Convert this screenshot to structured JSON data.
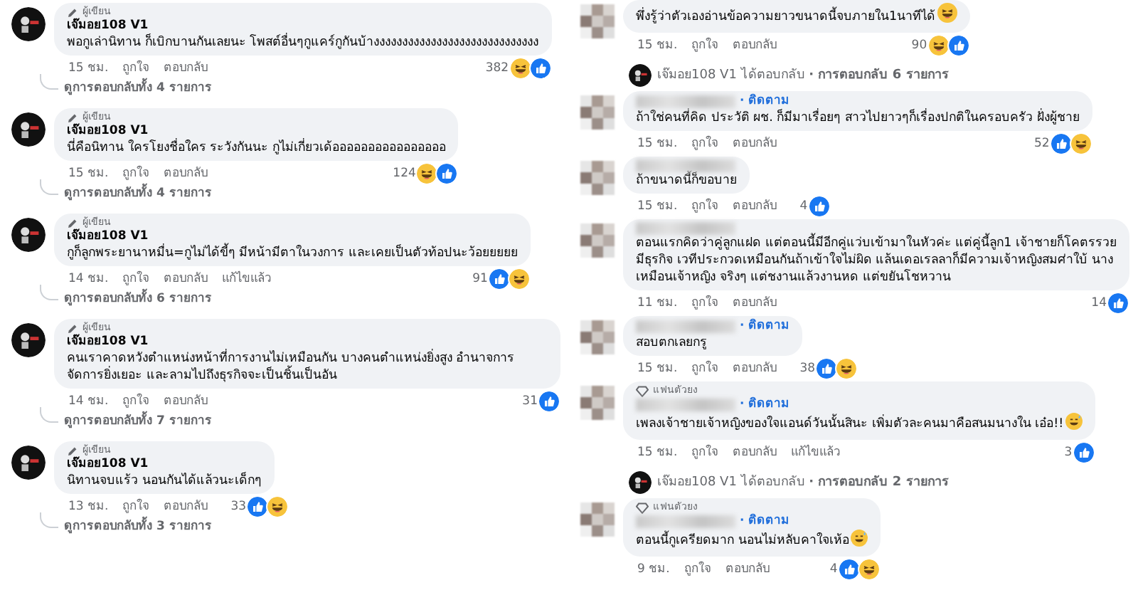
{
  "left": [
    {
      "avatar": {
        "kind": "logo"
      },
      "badge": {
        "kind": "author",
        "label": "ผู้เขียน"
      },
      "author": "เจ๊มอย108 V1",
      "text": "พอกูเล่านิทาน ก็เบิกบานกันเลยนะ โพสต์อื่นๆกูแคร์กูกันบ้างงงงงงงงงงงงงงงงงงงงงงงงงงงงง",
      "time": "15 ชม.",
      "like": "ถูกใจ",
      "reply": "ตอบกลับ",
      "reactions": [
        {
          "kind": "haha"
        },
        {
          "kind": "like"
        }
      ],
      "reaction_count": "382",
      "replies": "ดูการตอบกลับทั้ง 4 รายการ"
    },
    {
      "avatar": {
        "kind": "logo"
      },
      "badge": {
        "kind": "author",
        "label": "ผู้เขียน"
      },
      "author": "เจ๊มอย108 V1",
      "text": "นี่คือนิทาน ใครโยงชื่อใคร ระวังกันนะ กูไม่เกี่ยวเด้ออออออออออออออออ",
      "time": "15 ชม.",
      "like": "ถูกใจ",
      "reply": "ตอบกลับ",
      "reactions": [
        {
          "kind": "haha"
        },
        {
          "kind": "like"
        }
      ],
      "reaction_count": "124",
      "replies": "ดูการตอบกลับทั้ง 4 รายการ"
    },
    {
      "avatar": {
        "kind": "logo"
      },
      "badge": {
        "kind": "author",
        "label": "ผู้เขียน"
      },
      "author": "เจ๊มอย108 V1",
      "text": "กูก็ลูกพระยานาหมื่น=กูไม่ได้ขี้ๆ มีหน้ามีตาในวงการ และเคยเป็นตัวท้อปนะว้อยยยยย",
      "time": "14 ชม.",
      "like": "ถูกใจ",
      "reply": "ตอบกลับ",
      "edited": "แก้ไขแล้ว",
      "reactions": [
        {
          "kind": "like"
        },
        {
          "kind": "haha"
        }
      ],
      "reaction_count": "91",
      "replies": "ดูการตอบกลับทั้ง 6 รายการ"
    },
    {
      "avatar": {
        "kind": "logo"
      },
      "badge": {
        "kind": "author",
        "label": "ผู้เขียน"
      },
      "author": "เจ๊มอย108 V1",
      "text": "คนเราคาดหวังตำแหน่งหน้าที่การงานไม่เหมือนกัน บางคนตำแหน่งยิ่งสูง อำนาจการจัดการยิ่งเยอะ และลามไปถึงธุรกิจจะเป็นชิ้นเป็นอัน",
      "time": "14 ชม.",
      "like": "ถูกใจ",
      "reply": "ตอบกลับ",
      "reactions": [
        {
          "kind": "like"
        }
      ],
      "reaction_count": "31",
      "replies": "ดูการตอบกลับทั้ง 7 รายการ"
    },
    {
      "avatar": {
        "kind": "logo"
      },
      "badge": {
        "kind": "author",
        "label": "ผู้เขียน"
      },
      "author": "เจ๊มอย108 V1",
      "text": "นิทานจบแร้ว นอนกันได้แล้วนะเด็กๆ",
      "time": "13 ชม.",
      "like": "ถูกใจ",
      "reply": "ตอบกลับ",
      "reactions": [
        {
          "kind": "like"
        },
        {
          "kind": "haha"
        }
      ],
      "reaction_count": "33",
      "replies": "ดูการตอบกลับทั้ง 3 รายการ"
    }
  ],
  "right": [
    {
      "kind": "comment",
      "avatar": {
        "kind": "pixelated"
      },
      "text": "พึ่งรู้ว่าตัวเองอ่านข้อความยาวขนาดนี้จบภายใน1นาทีได้",
      "emoji": {
        "kind": "laughing"
      },
      "time": "15 ชม.",
      "like": "ถูกใจ",
      "reply": "ตอบกลับ",
      "reactions": [
        {
          "kind": "haha"
        },
        {
          "kind": "like"
        }
      ],
      "reaction_count": "90"
    },
    {
      "kind": "reply_summary",
      "author": "เจ๊มอย108 V1",
      "action": "ได้ตอบกลับ",
      "count": "· การตอบกลับ 6 รายการ"
    },
    {
      "kind": "comment",
      "avatar": {
        "kind": "pixelated"
      },
      "name_blurred": true,
      "follow": "· ติดตาม",
      "text": "ถ้าใช่คนที่คิด ประวัติ ผช. ก็มีมาเรื่อยๆ สาวไปยาวๆก็เรื่องปกติในครอบครัว ฝั่งผู้ชาย",
      "time": "15 ชม.",
      "like": "ถูกใจ",
      "reply": "ตอบกลับ",
      "reactions": [
        {
          "kind": "like"
        },
        {
          "kind": "haha"
        }
      ],
      "reaction_count": "52"
    },
    {
      "kind": "comment",
      "avatar": {
        "kind": "pixelated"
      },
      "name_blurred": true,
      "text": "ถ้าขนาดนี้ก็ขอบาย",
      "time": "15 ชม.",
      "like": "ถูกใจ",
      "reply": "ตอบกลับ",
      "reactions": [
        {
          "kind": "like"
        }
      ],
      "reaction_count": "4"
    },
    {
      "kind": "comment",
      "avatar": {
        "kind": "pixelated"
      },
      "name_blurred": true,
      "text": "ตอนแรกคิดว่าคู่ลูกแฝด แต่ตอนนี้มีอีกคู่แว่บเข้ามาในหัวค่ะ แต่คู่นี้ลูก1 เจ้าชายก็โคตรรวย มีธุรกิจ เวทีประกวดเหมือนกันถ้าเข้าใจไม่ผิด แล้นเดอเรลลาก็มีความเจ้าหญิงสมศ่าใบ้ นางเหมือนเจ้าหญิง จริงๆ แต่ชงานแล้วงานหด แต่ขยันโชหวาน",
      "time": "11 ชม.",
      "like": "ถูกใจ",
      "reply": "ตอบกลับ",
      "reactions": [
        {
          "kind": "like"
        }
      ],
      "reaction_count": "14"
    },
    {
      "kind": "comment",
      "avatar": {
        "kind": "pixelated"
      },
      "name_blurred": true,
      "follow": "· ติดตาม",
      "text": "สอบตกเลยกรู",
      "time": "15 ชม.",
      "like": "ถูกใจ",
      "reply": "ตอบกลับ",
      "reactions": [
        {
          "kind": "like"
        },
        {
          "kind": "haha"
        }
      ],
      "reaction_count": "38"
    },
    {
      "kind": "comment",
      "avatar": {
        "kind": "pixelated"
      },
      "badge": {
        "kind": "fan",
        "label": "แฟนตัวยง"
      },
      "name_blurred": true,
      "follow": "· ติดตาม",
      "text": "เพลงเจ้าชายเจ้าหญิงของใจแอนด์วันนั้นสินะ เพิ่มตัวละคนมาคือสนมนางใน เอ๋อ!!",
      "emoji": {
        "kind": "sweat_smile"
      },
      "time": "15 ชม.",
      "like": "ถูกใจ",
      "reply": "ตอบกลับ",
      "edited": "แก้ไขแล้ว",
      "reactions": [
        {
          "kind": "like"
        }
      ],
      "reaction_count": "3"
    },
    {
      "kind": "reply_summary",
      "author": "เจ๊มอย108 V1",
      "action": "ได้ตอบกลับ",
      "count": "· การตอบกลับ 2 รายการ"
    },
    {
      "kind": "comment",
      "avatar": {
        "kind": "pixelated"
      },
      "badge": {
        "kind": "fan",
        "label": "แฟนตัวยง"
      },
      "name_blurred": true,
      "follow": "· ติดตาม",
      "text": "ตอนนี้กูเครียดมาก นอนไม่หลับคาใจเห้อ",
      "emoji": {
        "kind": "sweat_smile"
      },
      "time": "9 ชม.",
      "like": "ถูกใจ",
      "reply": "ตอบกลับ",
      "reactions": [
        {
          "kind": "like"
        },
        {
          "kind": "haha"
        }
      ],
      "reaction_count": "4"
    }
  ]
}
